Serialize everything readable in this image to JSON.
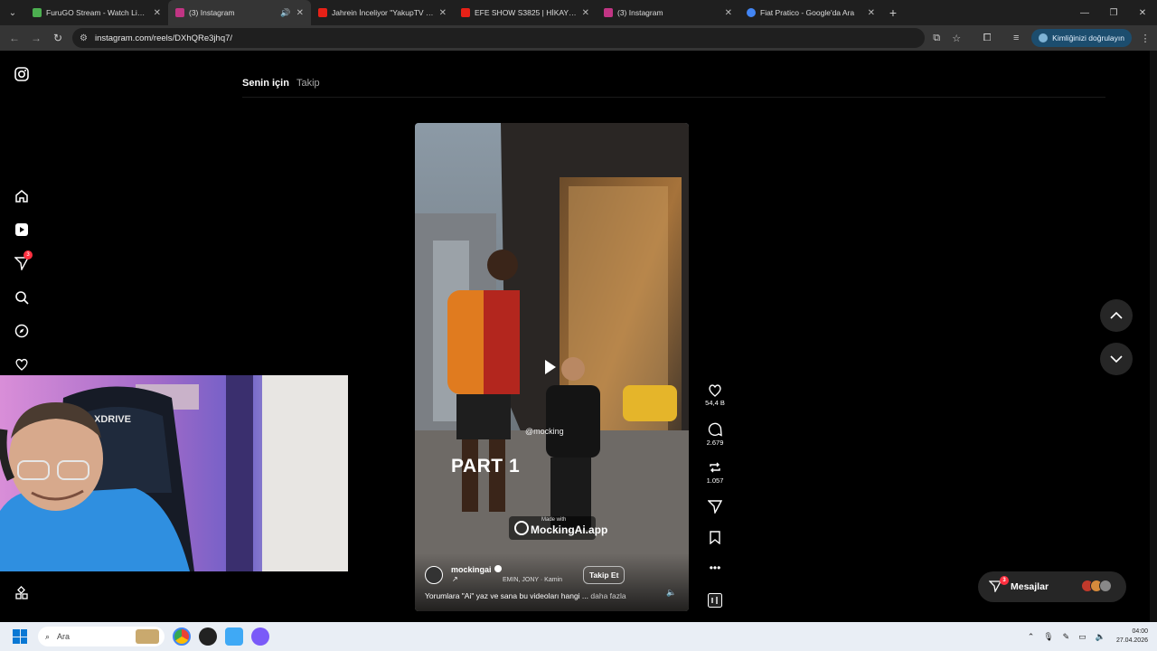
{
  "browser": {
    "tabs": [
      {
        "title": "FuruGO Stream - Watch Live or",
        "favicon_color": "#4caf50",
        "active": false
      },
      {
        "title": "(3) Instagram",
        "favicon_color": "#c13584",
        "active": true
      },
      {
        "title": "Jahrein İnceliyor \"YakupTV Jeta",
        "favicon_color": "#e62117",
        "active": false
      },
      {
        "title": "EFE SHOW S3825 | HİKAYEDEN",
        "favicon_color": "#e62117",
        "active": false
      },
      {
        "title": "(3) Instagram",
        "favicon_color": "#c13584",
        "active": false
      },
      {
        "title": "Fiat Pratico - Google'da Ara",
        "favicon_color": "#4285f4",
        "active": false
      }
    ],
    "url": "instagram.com/reels/DXhQRe3jhq7/",
    "verify_label": "Kimliğinizi doğrulayın"
  },
  "instagram": {
    "nav_badge": "3",
    "feed_tabs": {
      "for_you": "Senin için",
      "following": "Takip"
    },
    "reel": {
      "overlay_text": "PART 1",
      "watermark_small": "Made with",
      "watermark_large": "MockingAi.app",
      "handle_overlay": "@mocking",
      "username": "mockingai",
      "subtitle": "EMIN, JONY · Kamin",
      "follow_label": "Takip Et",
      "caption": "Yorumlara \"Ai\" yaz ve sana bu videoları hangi ...",
      "caption_more": "daha fazla"
    },
    "actions": {
      "likes": "54,4 B",
      "comments": "2.679",
      "reposts": "1.057"
    },
    "messages": {
      "label": "Mesajlar",
      "badge": "3"
    },
    "brand_colors": {
      "badge": "#ff3040",
      "background": "#000000"
    }
  },
  "webcam": {
    "shirt_text": "XDRIVE"
  },
  "taskbar": {
    "search_placeholder": "Ara",
    "time": "04:00",
    "date": "27.04.2026"
  }
}
